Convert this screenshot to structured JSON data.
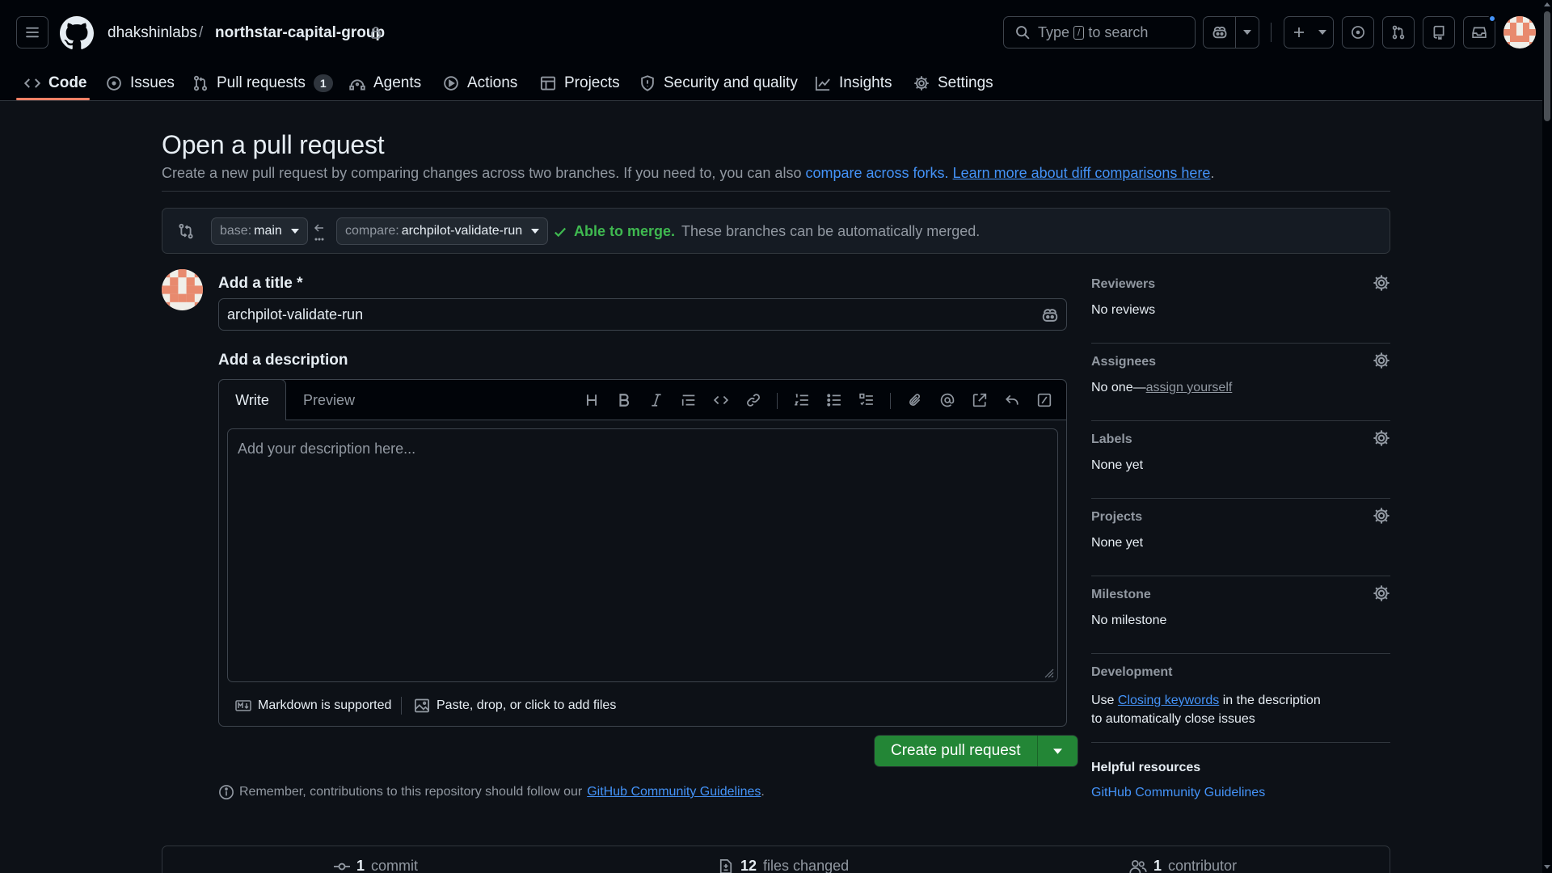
{
  "repo": {
    "owner": "dhakshinlabs",
    "separator": "/",
    "name": "northstar-capital-group"
  },
  "search": {
    "pre": "Type",
    "key": "/",
    "post": "to search"
  },
  "tabs": [
    {
      "label": "Code",
      "active": true
    },
    {
      "label": "Issues"
    },
    {
      "label": "Pull requests",
      "count": "1"
    },
    {
      "label": "Agents"
    },
    {
      "label": "Actions"
    },
    {
      "label": "Projects"
    },
    {
      "label": "Security and quality"
    },
    {
      "label": "Insights"
    },
    {
      "label": "Settings"
    }
  ],
  "page": {
    "title": "Open a pull request",
    "intro_text": "Create a new pull request by comparing changes across two branches. If you need to, you can also",
    "intro_link1": "compare across forks.",
    "intro_link2": "Learn more about diff comparisons here",
    "intro_end": "."
  },
  "range": {
    "base_label": "base:",
    "base_value": "main",
    "compare_label": "compare:",
    "compare_value": "archpilot-validate-run",
    "merge_status": "Able to merge.",
    "merge_detail": "These branches can be automatically merged."
  },
  "form": {
    "title_label": "Add a title *",
    "title_value": "archpilot-validate-run",
    "desc_label": "Add a description",
    "tab_write": "Write",
    "tab_preview": "Preview",
    "desc_placeholder": "Add your description here...",
    "markdown_note": "Markdown is supported",
    "attach_note": "Paste, drop, or click to add files",
    "submit_label": "Create pull request",
    "remember_text": "Remember, contributions to this repository should follow our",
    "remember_link": "GitHub Community Guidelines",
    "remember_end": "."
  },
  "toolbar_icons": [
    "heading-icon",
    "bold-icon",
    "italic-icon",
    "quote-icon",
    "code-icon",
    "link-icon",
    "ordered-list-icon",
    "unordered-list-icon",
    "task-list-icon",
    "attach-icon",
    "mention-icon",
    "reference-icon",
    "reply-icon",
    "slash-command-icon"
  ],
  "sidebar": {
    "reviewers": {
      "heading": "Reviewers",
      "value": "No reviews"
    },
    "assignees": {
      "heading": "Assignees",
      "value": "No one—",
      "link": "assign yourself"
    },
    "labels": {
      "heading": "Labels",
      "value": "None yet"
    },
    "projects": {
      "heading": "Projects",
      "value": "None yet"
    },
    "milestone": {
      "heading": "Milestone",
      "value": "No milestone"
    },
    "development": {
      "heading": "Development",
      "pre": "Use",
      "link": "Closing keywords",
      "post": "in the description to automatically close issues"
    },
    "helpful": {
      "heading": "Helpful resources",
      "link": "GitHub Community Guidelines"
    }
  },
  "stats": {
    "commits_count": "1",
    "commits_label": "commit",
    "files_count": "12",
    "files_label": "files changed",
    "contributors_count": "1",
    "contributors_label": "contributor"
  },
  "colors": {
    "background": "#0d1117",
    "header": "#010409",
    "accent_link": "#4493f8",
    "success": "#238636",
    "merge_text": "#3fb950",
    "tab_underline": "#f78166",
    "notification_dot": "#4493f8"
  }
}
